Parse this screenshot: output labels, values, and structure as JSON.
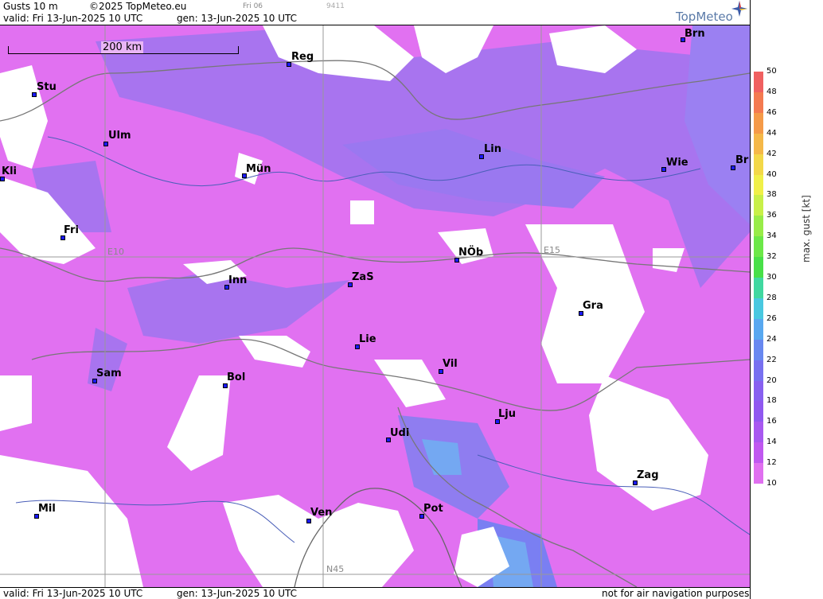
{
  "header": {
    "title": "Gusts 10 m",
    "copyright": "©2025 TopMeteo.eu",
    "valid_line": "valid:  Fri  13-Jun-2025  10 UTC",
    "gen_line": "gen: 13-Jun-2025 10 UTC",
    "small_code": "Fri 06",
    "small_num": "9411",
    "logo": "TopMeteo"
  },
  "footer": {
    "valid_line": "valid:  Fri  13-Jun-2025  10 UTC",
    "gen_line": "gen: 13-Jun-2025 10 UTC",
    "disclaimer": "not for air navigation purposes"
  },
  "scale_bar": {
    "label": "200 km"
  },
  "grid_labels": {
    "e10": "E10",
    "e15": "E15",
    "n45": "N45"
  },
  "cities": [
    {
      "name": "Brn"
    },
    {
      "name": "Reg"
    },
    {
      "name": "Stu"
    },
    {
      "name": "Ulm"
    },
    {
      "name": "Lin"
    },
    {
      "name": "Kli"
    },
    {
      "name": "Mün"
    },
    {
      "name": "Wie"
    },
    {
      "name": "Br"
    },
    {
      "name": "Fri"
    },
    {
      "name": "NÖb"
    },
    {
      "name": "Inn"
    },
    {
      "name": "ZaS"
    },
    {
      "name": "Gra"
    },
    {
      "name": "Lie"
    },
    {
      "name": "Vil"
    },
    {
      "name": "Sam"
    },
    {
      "name": "Bol"
    },
    {
      "name": "Lju"
    },
    {
      "name": "Udi"
    },
    {
      "name": "Zag"
    },
    {
      "name": "Mil"
    },
    {
      "name": "Ven"
    },
    {
      "name": "Pot"
    }
  ],
  "legend": {
    "unit_label": "max. gust [kt]",
    "ticks": [
      "50",
      "48",
      "46",
      "44",
      "42",
      "40",
      "38",
      "36",
      "34",
      "32",
      "30",
      "28",
      "26",
      "24",
      "22",
      "20",
      "18",
      "16",
      "14",
      "12",
      "10"
    ],
    "colors": [
      "#f06060",
      "#f47a50",
      "#f59a48",
      "#f5b848",
      "#f3d848",
      "#f0f048",
      "#c8f048",
      "#98ec48",
      "#6ce848",
      "#48e048",
      "#40d8a0",
      "#48c8e0",
      "#58a8f0",
      "#6888f0",
      "#7870f0",
      "#8860f0",
      "#9058f0",
      "#a858f0",
      "#c058f0",
      "#e070f0"
    ]
  },
  "colors": {
    "pink": "#e171f1",
    "violet": "#a874ef",
    "blue": "#7a7ff2",
    "lightblue": "#74a8f2",
    "white": "#ffffff"
  }
}
